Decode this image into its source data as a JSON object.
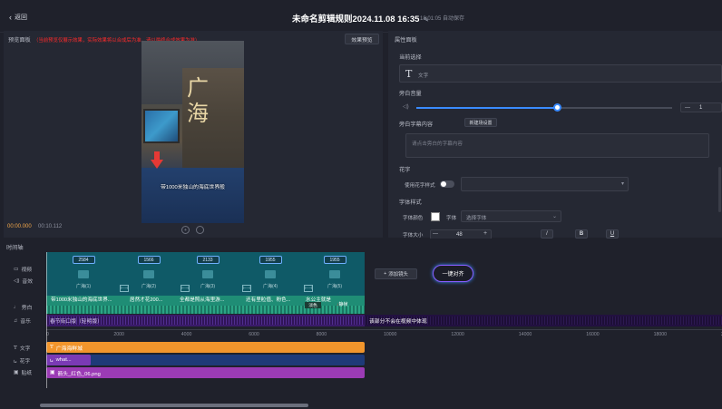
{
  "header": {
    "back_label": "返回",
    "title": "未命名剪辑规则2024.11.08 16:35",
    "autosave": "18:01:05 自动保存"
  },
  "preview": {
    "panel_title": "预览面板",
    "warning": "（当前预览仅展示效果，实际效果将以合成后为准，请以最终合成效果为准）",
    "effect_button": "效果预览",
    "video_overlay_text": "带1000米独山的海底世界般",
    "signage_text": "广海",
    "time_current": "00:00.000",
    "time_total": "00:10.112"
  },
  "props": {
    "panel_title": "属性面板",
    "current_select_label": "当前选择",
    "current_select_value": "文字",
    "volume_label": "旁白音量",
    "volume_value": "1",
    "volume_fraction": 0.55,
    "subtitle_label": "旁白字幕内容",
    "subtitle_btn": "新建场设置",
    "subtitle_placeholder": "请点击旁白的字幕内容",
    "fancy_label": "花字",
    "fancy_toggle_label": "使用花字样式",
    "font_style_label": "字体样式",
    "font_color_label": "字体颜色",
    "font_label": "字体",
    "font_select": "选择字体",
    "font_size_label": "字体大小",
    "font_size_value": "48",
    "minus": "—",
    "plus": "+",
    "style_buttons": [
      "/",
      "B",
      "U"
    ]
  },
  "timeline": {
    "label": "时间轴",
    "tracks": {
      "video": "视频",
      "audio_fx": "音效",
      "narration": "旁白",
      "music": "音乐",
      "text": "文字",
      "flower": "花字",
      "sticker": "贴纸"
    },
    "clips": [
      {
        "duration": "2584",
        "name": "广海(1)"
      },
      {
        "duration": "1566",
        "name": "广海(2)"
      },
      {
        "duration": "2133",
        "name": "广海(3)"
      },
      {
        "duration": "1955",
        "name": "广海(4)"
      },
      {
        "duration": "1955",
        "name": "广海(5)"
      }
    ],
    "add_shot": "添加镜头",
    "align_button": "一键对齐",
    "subtitles": [
      "带1000米独山的海底世界...",
      "居然才花200...",
      "全都是照从海里游...",
      "还有里粒值、粉色...",
      "水公主就是"
    ],
    "sub_tags": [
      "淡色",
      "静帧"
    ],
    "music_name": "春节街口版（轻明版）",
    "overflow_note": "该部分不会在视频中体现",
    "ruler": [
      "0",
      "2000",
      "4000",
      "6000",
      "8000",
      "10000",
      "12000",
      "14000",
      "16000",
      "18000",
      "20000"
    ],
    "text_bar": "广海海鲜城",
    "flower_bar": "what...",
    "sticker_bar": "箭头_红色_06.png"
  },
  "colors": {
    "accent_blue": "#3a8bff",
    "video_track": "#0f5a67",
    "sub_track": "#1f8d75",
    "music_track": "#3a1a6a",
    "text_bar": "#f1952c",
    "flower_bar": "#2a4fa0",
    "sticker_bar": "#9b3bb5"
  }
}
